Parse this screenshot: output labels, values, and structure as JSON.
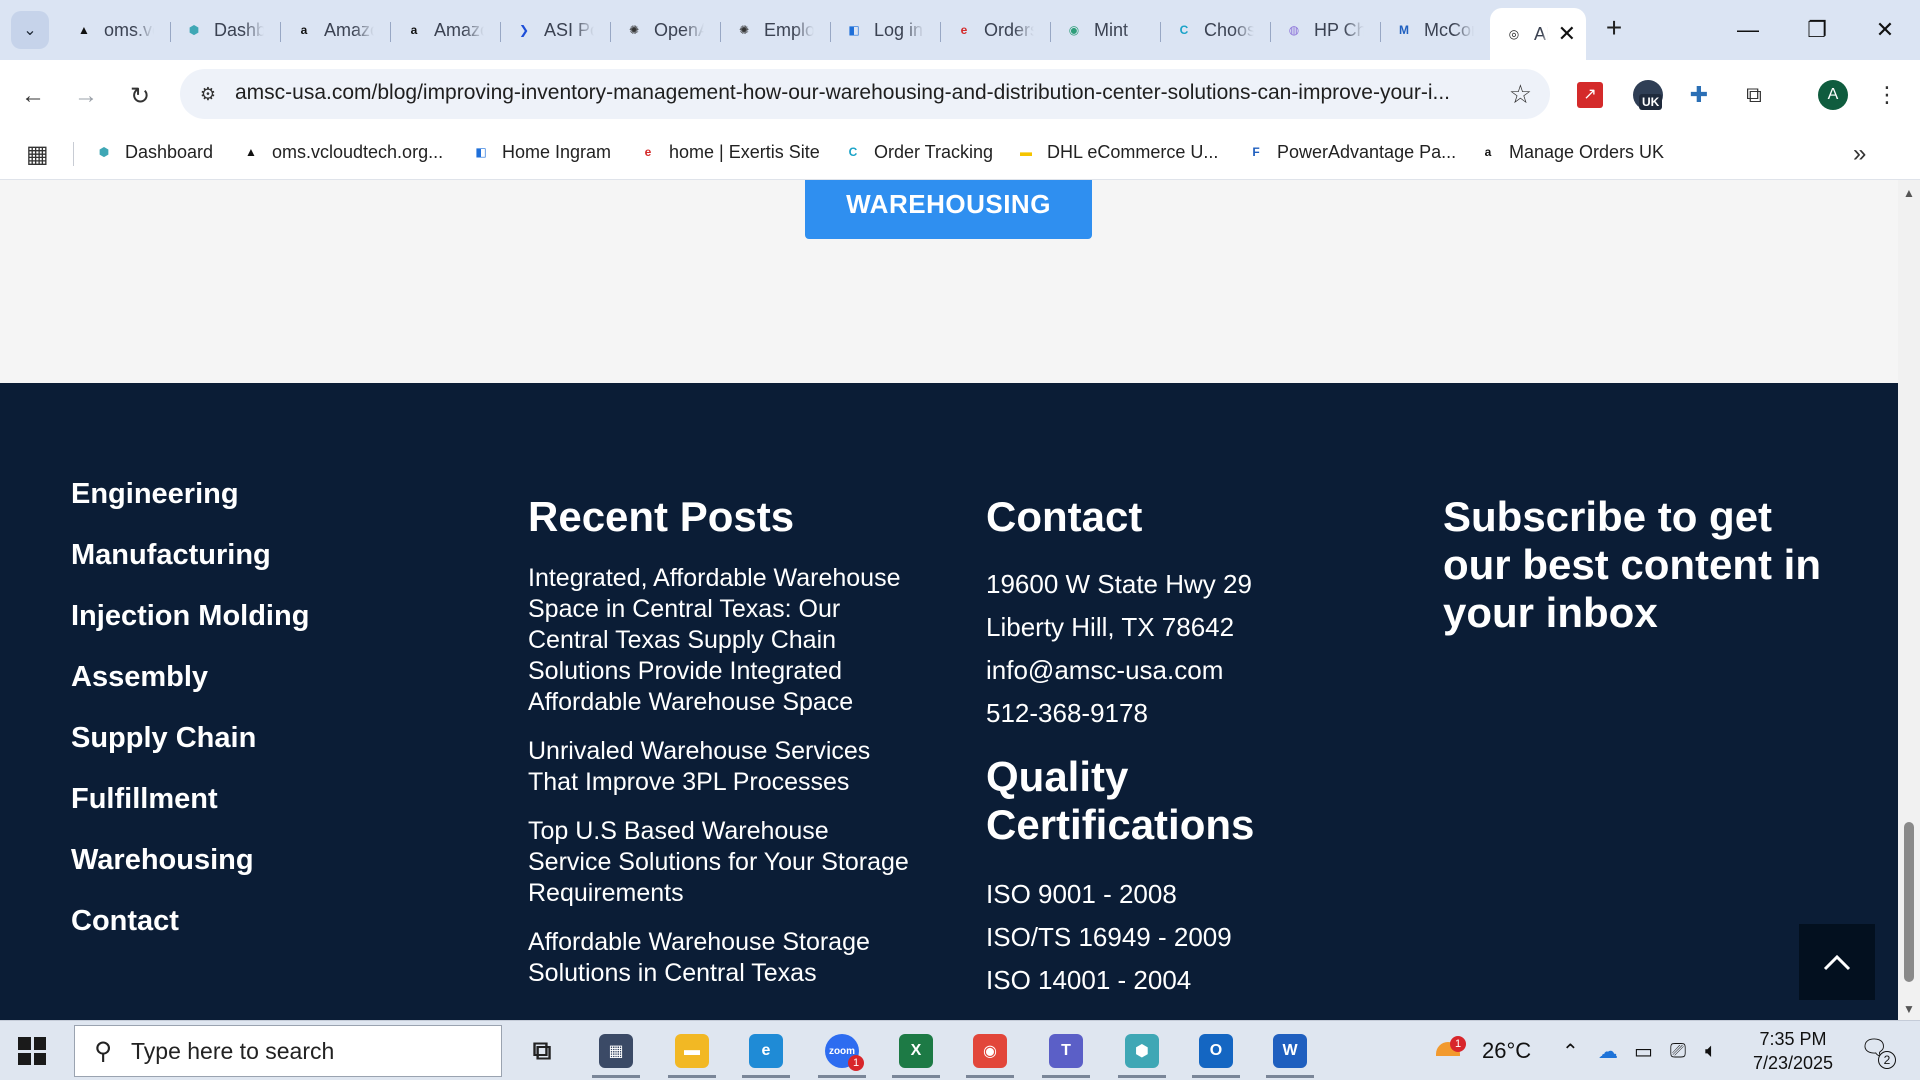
{
  "browser": {
    "tabs": [
      {
        "title": "oms.vcloudtech",
        "icon": "triangle-logo-icon",
        "color": "#111111",
        "glyph": "▲"
      },
      {
        "title": "Dashboard",
        "icon": "hexagon-logo-icon",
        "color": "#3fa7b5",
        "glyph": "⬢"
      },
      {
        "title": "Amazon",
        "icon": "amazon-logo-icon",
        "color": "#111111",
        "glyph": "a"
      },
      {
        "title": "Amazon",
        "icon": "amazon-logo-icon",
        "color": "#111111",
        "glyph": "a"
      },
      {
        "title": "ASI Portal",
        "icon": "chevron-logo-icon",
        "color": "#1d4ed8",
        "glyph": "❯"
      },
      {
        "title": "OpenAI",
        "icon": "openai-logo-icon",
        "color": "#333333",
        "glyph": "✺"
      },
      {
        "title": "Employee",
        "icon": "openai-logo-icon",
        "color": "#333333",
        "glyph": "✺"
      },
      {
        "title": "Log in",
        "icon": "ingram-logo-icon",
        "color": "#1e6fd9",
        "glyph": "◧"
      },
      {
        "title": "Orders",
        "icon": "exertis-logo-icon",
        "color": "#d42a2a",
        "glyph": "e"
      },
      {
        "title": "Mint",
        "icon": "mint-logo-icon",
        "color": "#2f9e7a",
        "glyph": "◉"
      },
      {
        "title": "Choose",
        "icon": "c-logo-icon",
        "color": "#1aa3c8",
        "glyph": "C"
      },
      {
        "title": "HP Channel",
        "icon": "hp-logo-icon",
        "color": "#8a6fd8",
        "glyph": "◍"
      },
      {
        "title": "McCormick",
        "icon": "m-logo-icon",
        "color": "#1f5fbf",
        "glyph": "M"
      },
      {
        "title": "AMSC",
        "icon": "amsc-logo-icon",
        "color": "#222222",
        "glyph": "◎",
        "active": true
      }
    ],
    "url": "amsc-usa.com/blog/improving-inventory-management-how-our-warehousing-and-distribution-center-solutions-can-improve-your-i...",
    "bookmarks": [
      {
        "label": "Dashboard",
        "icon": "hexagon-logo-icon",
        "color": "#3fa7b5",
        "glyph": "⬢"
      },
      {
        "label": "oms.vcloudtech.org...",
        "icon": "triangle-logo-icon",
        "color": "#111111",
        "glyph": "▲"
      },
      {
        "label": "Home Ingram",
        "icon": "ingram-logo-icon",
        "color": "#1e6fd9",
        "glyph": "◧"
      },
      {
        "label": "home | Exertis Site",
        "icon": "exertis-logo-icon",
        "color": "#d42a2a",
        "glyph": "e"
      },
      {
        "label": "Order Tracking",
        "icon": "c-logo-icon",
        "color": "#1aa3c8",
        "glyph": "C"
      },
      {
        "label": "DHL eCommerce U...",
        "icon": "dhl-logo-icon",
        "color": "#f5c400",
        "glyph": "▬"
      },
      {
        "label": "PowerAdvantage Pa...",
        "icon": "f-logo-icon",
        "color": "#1f5fbf",
        "glyph": "F"
      },
      {
        "label": "Manage Orders UK",
        "icon": "amazon-logo-icon",
        "color": "#111111",
        "glyph": "a"
      }
    ],
    "extension_badge": "UK",
    "profile_initial": "A"
  },
  "page": {
    "cta_label": "WAREHOUSING",
    "footer": {
      "nav_links": [
        "Engineering",
        "Manufacturing",
        "Injection Molding",
        "Assembly",
        "Supply Chain",
        "Fulfillment",
        "Warehousing",
        "Contact"
      ],
      "recent_posts_heading": "Recent Posts",
      "recent_posts": [
        "Integrated, Affordable Warehouse Space in Central Texas: Our Central Texas Supply Chain Solutions Provide Integrated Affordable Warehouse Space",
        "Unrivaled Warehouse Services That Improve 3PL Processes",
        "Top U.S Based Warehouse Service Solutions for Your Storage Requirements",
        "Affordable Warehouse Storage Solutions in Central Texas"
      ],
      "contact_heading": "Contact",
      "contact_lines": [
        "19600 W State Hwy 29",
        "Liberty Hill, TX 78642",
        "info@amsc-usa.com",
        "512-368-9178"
      ],
      "quality_heading": "Quality Certifications",
      "certifications": [
        "ISO 9001 - 2008",
        "ISO/TS 16949 - 2009",
        "ISO 14001 - 2004"
      ],
      "subscribe_heading": "Subscribe to get our best content in your inbox"
    },
    "colors": {
      "footer_bg": "#0b1d36",
      "cta_bg": "#2f8ff0",
      "upper_bg": "#f5f5f5"
    }
  },
  "taskbar": {
    "search_placeholder": "Type here to search",
    "apps": [
      {
        "name": "task-view",
        "glyph": "⧉",
        "color": "transparent"
      },
      {
        "name": "calculator",
        "glyph": "▦",
        "color": "#3b4a66"
      },
      {
        "name": "file-explorer",
        "glyph": "▬",
        "color": "#f2b824"
      },
      {
        "name": "edge",
        "glyph": "e",
        "color": "#1f8bd6"
      },
      {
        "name": "zoom",
        "glyph": "zoom",
        "color": "#2d6cf0",
        "badge": "1"
      },
      {
        "name": "excel",
        "glyph": "X",
        "color": "#1d7a45"
      },
      {
        "name": "chrome",
        "glyph": "◉",
        "color": "#e2463a"
      },
      {
        "name": "teams",
        "glyph": "T",
        "color": "#5b5fc7"
      },
      {
        "name": "app-gem",
        "glyph": "⬢",
        "color": "#3fa7b5"
      },
      {
        "name": "outlook",
        "glyph": "O",
        "color": "#1466c2"
      },
      {
        "name": "word",
        "glyph": "W",
        "color": "#1f5fbf"
      }
    ],
    "weather_temp": "26°C",
    "weather_badge": "1",
    "time": "7:35 PM",
    "date": "7/23/2025",
    "notification_count": "2"
  }
}
